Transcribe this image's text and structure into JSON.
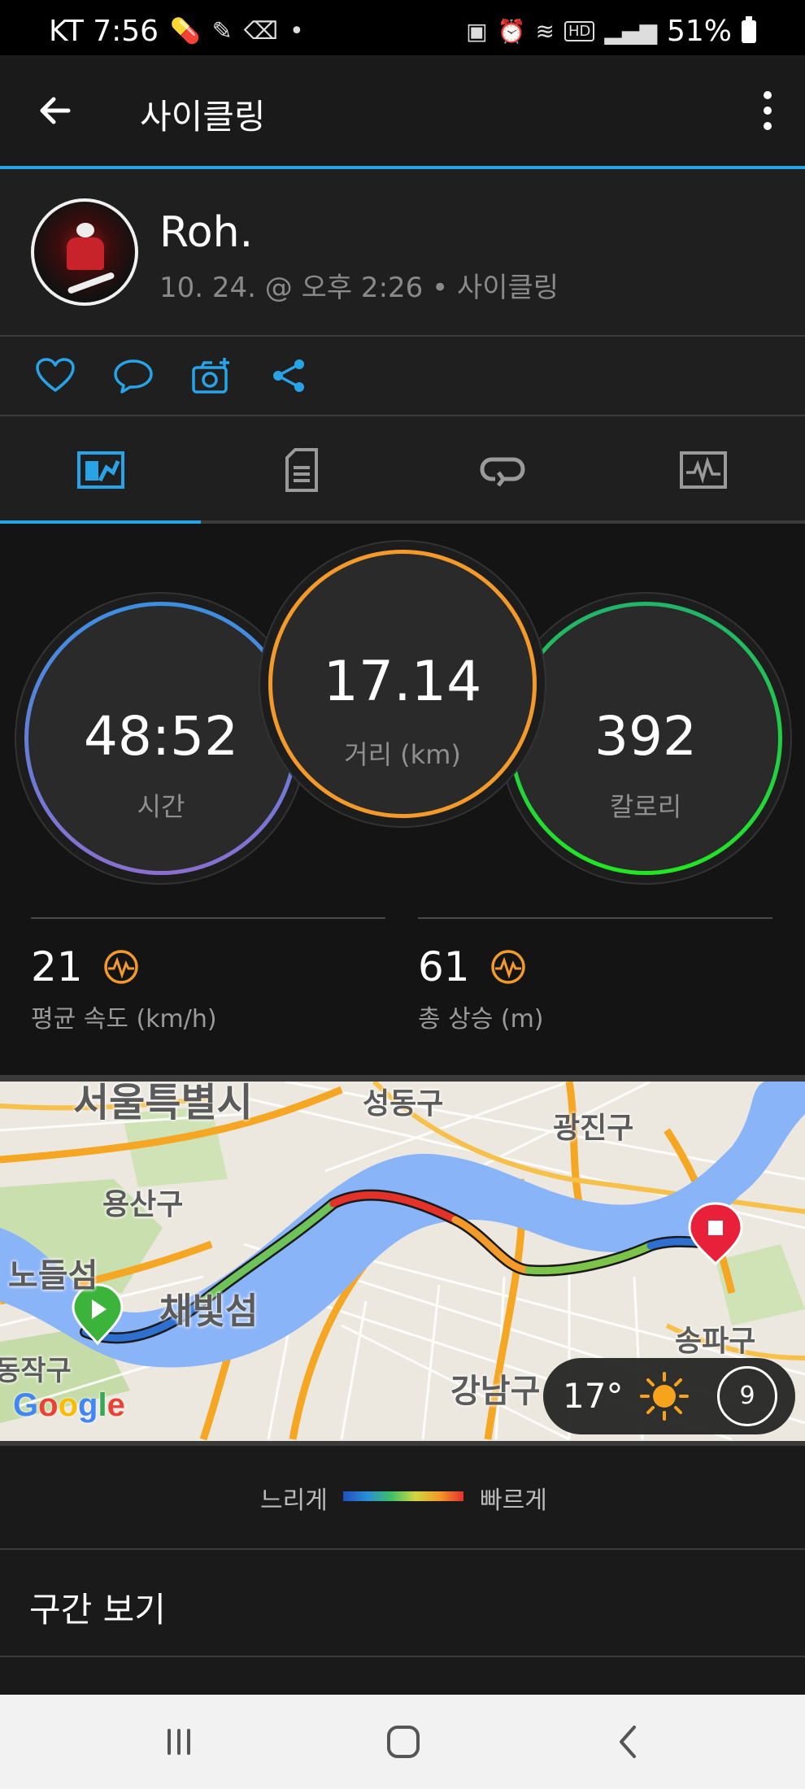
{
  "status_bar": {
    "carrier_time": "KT 7:56",
    "left_icons": [
      "pill-icon",
      "pen-icon",
      "broom-icon",
      "dot-icon"
    ],
    "right_icons": [
      "lock-icon",
      "alarm-icon",
      "wifi-icon",
      "hd-icon",
      "signal-icon"
    ],
    "battery": "51%"
  },
  "app_bar": {
    "title": "사이클링",
    "accent": "#29a3e8"
  },
  "profile": {
    "name": "Roh.",
    "meta": "10. 24. @ 오후 2:26 • 사이클링"
  },
  "actions": [
    "heart-icon",
    "comment-icon",
    "add-photo-icon",
    "share-icon"
  ],
  "tabs": [
    {
      "icon": "overview-icon",
      "active": true
    },
    {
      "icon": "details-icon",
      "active": false
    },
    {
      "icon": "laps-icon",
      "active": false
    },
    {
      "icon": "charts-icon",
      "active": false
    }
  ],
  "stats": {
    "time": {
      "value": "48:52",
      "label": "시간"
    },
    "distance": {
      "value": "17.14",
      "label": "거리 (km)"
    },
    "calories": {
      "value": "392",
      "label": "칼로리"
    },
    "avg_speed": {
      "value": "21",
      "label": "평균 속도 (km/h)"
    },
    "ascent": {
      "value": "61",
      "label": "총 상승 (m)"
    }
  },
  "map": {
    "labels": {
      "seoul": "서울특별시",
      "seongdong": "성동구",
      "gwangjin": "광진구",
      "yongsan": "용산구",
      "nodeul": "노들섬",
      "chaebit": "채빛섬",
      "songpa": "송파구",
      "dongjak": "동작구",
      "gangnam": "강남구"
    },
    "google": "Google",
    "weather": {
      "temp": "17°",
      "wind": "9"
    }
  },
  "legend": {
    "slow": "느리게",
    "fast": "빠르게"
  },
  "section": {
    "title": "구간 보기"
  }
}
